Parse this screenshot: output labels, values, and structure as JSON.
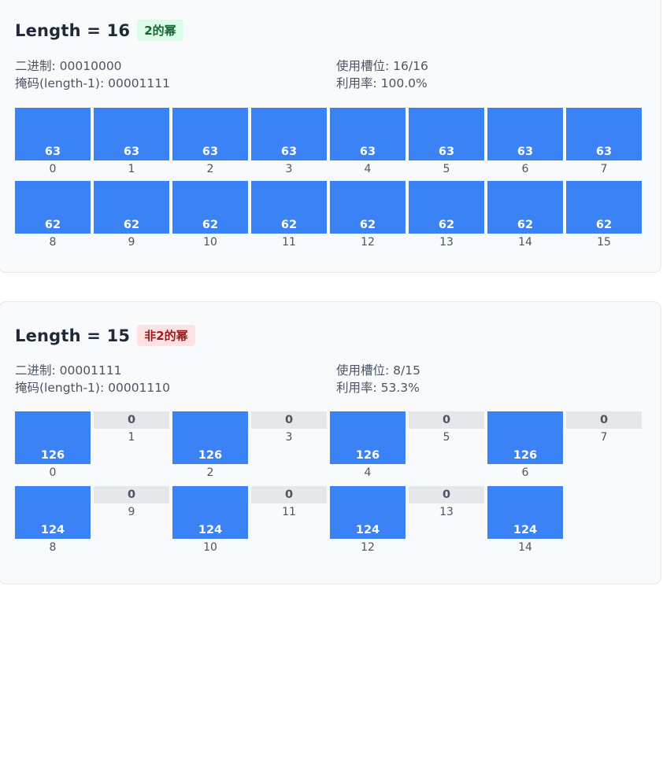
{
  "panels": [
    {
      "title": "Length = 16",
      "badge": "2的幂",
      "binary": "二进制: 00010000",
      "mask": "掩码(length-1): 00001111",
      "used": "使用槽位: 16/16",
      "rate": "利用率: 100.0%",
      "slots": [
        {
          "index": "0",
          "count": "63"
        },
        {
          "index": "1",
          "count": "63"
        },
        {
          "index": "2",
          "count": "63"
        },
        {
          "index": "3",
          "count": "63"
        },
        {
          "index": "4",
          "count": "63"
        },
        {
          "index": "5",
          "count": "63"
        },
        {
          "index": "6",
          "count": "63"
        },
        {
          "index": "7",
          "count": "63"
        },
        {
          "index": "8",
          "count": "62"
        },
        {
          "index": "9",
          "count": "62"
        },
        {
          "index": "10",
          "count": "62"
        },
        {
          "index": "11",
          "count": "62"
        },
        {
          "index": "12",
          "count": "62"
        },
        {
          "index": "13",
          "count": "62"
        },
        {
          "index": "14",
          "count": "62"
        },
        {
          "index": "15",
          "count": "62"
        }
      ]
    },
    {
      "title": "Length = 15",
      "badge": "非2的幂",
      "binary": "二进制: 00001111",
      "mask": "掩码(length-1): 00001110",
      "used": "使用槽位: 8/15",
      "rate": "利用率: 53.3%",
      "slots": [
        {
          "index": "0",
          "count": "126"
        },
        {
          "index": "1",
          "count": "0"
        },
        {
          "index": "2",
          "count": "126"
        },
        {
          "index": "3",
          "count": "0"
        },
        {
          "index": "4",
          "count": "126"
        },
        {
          "index": "5",
          "count": "0"
        },
        {
          "index": "6",
          "count": "126"
        },
        {
          "index": "7",
          "count": "0"
        },
        {
          "index": "8",
          "count": "124"
        },
        {
          "index": "9",
          "count": "0"
        },
        {
          "index": "10",
          "count": "124"
        },
        {
          "index": "11",
          "count": "0"
        },
        {
          "index": "12",
          "count": "124"
        },
        {
          "index": "13",
          "count": "0"
        },
        {
          "index": "14",
          "count": "124"
        }
      ]
    }
  ],
  "colors": {
    "used_slot": "#3b82f6",
    "empty_slot": "#e5e7eb",
    "badge_ok_bg": "#dcfce7",
    "badge_bad_bg": "#fee2e2"
  }
}
